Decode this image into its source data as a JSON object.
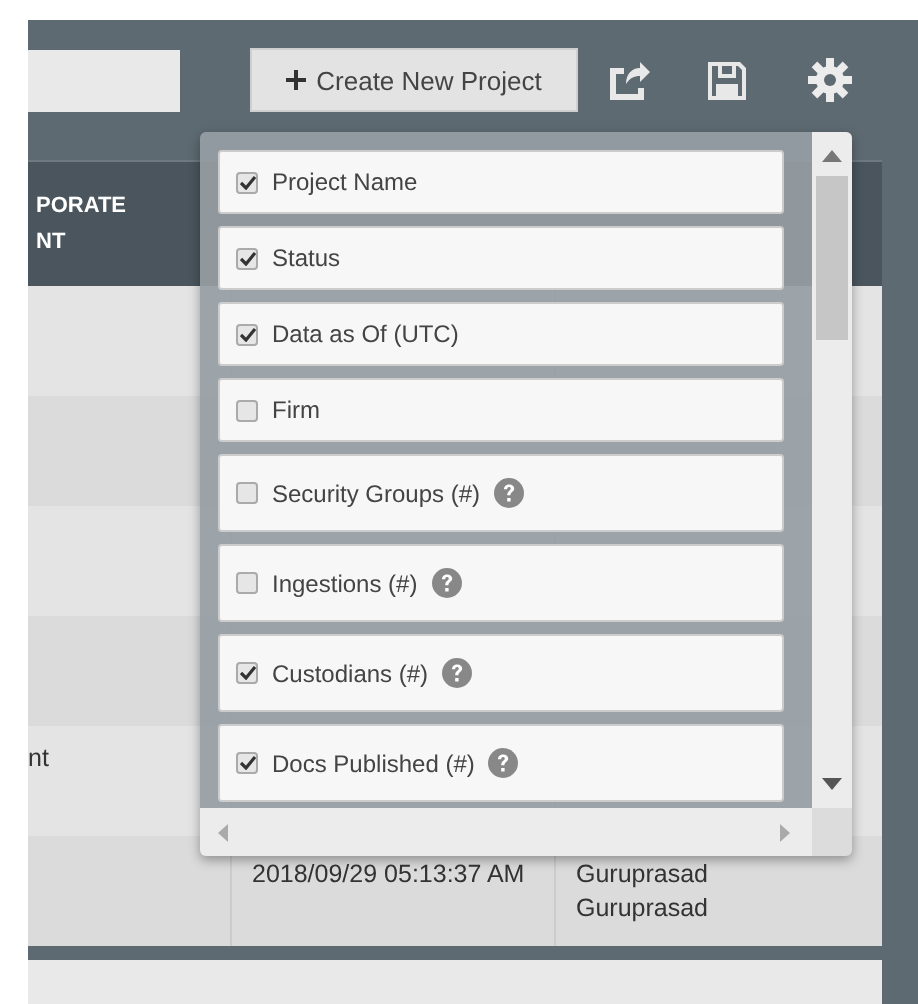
{
  "toolbar": {
    "create_button": "Create New Project"
  },
  "table": {
    "header_lines": [
      "PORATE",
      "NT"
    ],
    "rows": [
      {},
      {},
      {},
      {},
      {
        "column_1": "nt"
      },
      {
        "column_2": "2018/09/29 05:13:37 AM",
        "column_3": "Guruprasad Guruprasad"
      }
    ]
  },
  "column_picker": {
    "items": [
      {
        "label": "Project Name",
        "checked": true,
        "help": false
      },
      {
        "label": "Status",
        "checked": true,
        "help": false
      },
      {
        "label": "Data as Of (UTC)",
        "checked": true,
        "help": false
      },
      {
        "label": "Firm",
        "checked": false,
        "help": false
      },
      {
        "label": "Security Groups (#)",
        "checked": false,
        "help": true
      },
      {
        "label": "Ingestions (#)",
        "checked": false,
        "help": true
      },
      {
        "label": "Custodians (#)",
        "checked": true,
        "help": true
      },
      {
        "label": "Docs Published (#)",
        "checked": true,
        "help": true
      }
    ]
  }
}
